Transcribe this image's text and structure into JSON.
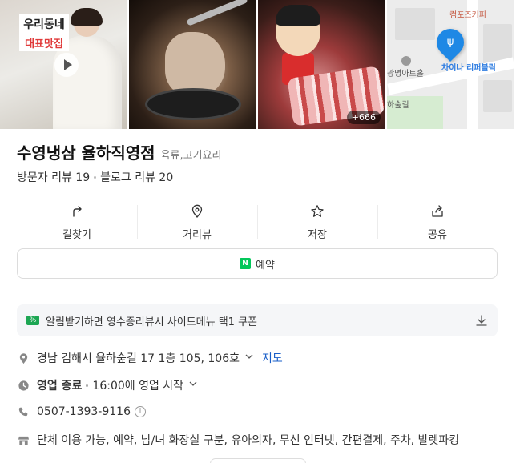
{
  "photos": {
    "tag_line1": "우리동네",
    "tag_line2": "대표맛집",
    "more_count": "+666",
    "map_label_top": "컴포즈커피",
    "map_label_left": "광명아트홀",
    "map_label_bottom": "하숲길",
    "map_label_pin": "차이나 리퍼블릭"
  },
  "place": {
    "name": "수영냉삼 율하직영점",
    "category": "육류,고기요리",
    "visitor_reviews": "방문자 리뷰 19",
    "blog_reviews": "블로그 리뷰 20"
  },
  "actions": [
    {
      "label": "길찾기",
      "icon": "directions-icon"
    },
    {
      "label": "거리뷰",
      "icon": "street-view-icon"
    },
    {
      "label": "저장",
      "icon": "star-icon"
    },
    {
      "label": "공유",
      "icon": "share-icon"
    }
  ],
  "reserve": {
    "badge": "N",
    "label": "예약"
  },
  "coupon": {
    "badge": "%",
    "text": "알림받기하면 영수증리뷰시 사이드메뉴 택1 쿠폰"
  },
  "info": {
    "address": "경남 김해시 율하숲길 17 1층 105, 106호",
    "map_link": "지도",
    "status": "영업 종료",
    "hours": "16:00에 영업 시작",
    "phone": "0507-1393-9116",
    "phone_info": "i",
    "amenities": "단체 이용 가능, 예약, 남/녀 화장실 구분, 유아의자, 무선 인터넷, 간편결제, 주차, 발렛파킹"
  },
  "colors": {
    "accent_green": "#03c75a",
    "link_blue": "#1a5fc8",
    "map_pin": "#1e88e5"
  }
}
